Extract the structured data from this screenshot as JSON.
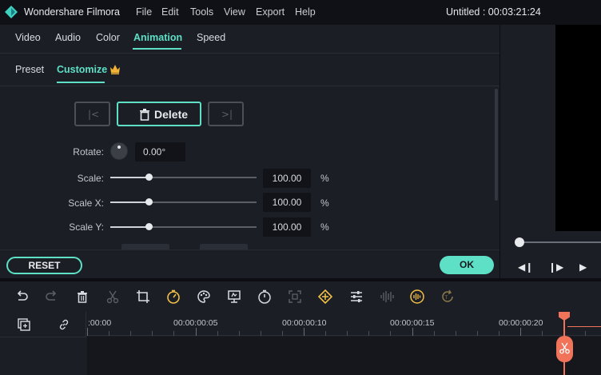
{
  "app": {
    "name": "Wondershare Filmora",
    "project_title": "Untitled : 00:03:21:24"
  },
  "menu": [
    "File",
    "Edit",
    "Tools",
    "View",
    "Export",
    "Help"
  ],
  "edit_tabs": [
    "Video",
    "Audio",
    "Color",
    "Animation",
    "Speed"
  ],
  "edit_tab_active": "Animation",
  "animation_tabs": [
    "Preset",
    "Customize"
  ],
  "animation_tab_active": "Customize",
  "keyframe": {
    "delete_label": "Delete"
  },
  "properties": {
    "rotate": {
      "label": "Rotate:",
      "value": "0.00°"
    },
    "scale": {
      "label": "Scale:",
      "value": "100.00",
      "unit": "%",
      "level": 0.26
    },
    "scale_x": {
      "label": "Scale X:",
      "value": "100.00",
      "unit": "%",
      "level": 0.26
    },
    "scale_y": {
      "label": "Scale Y:",
      "value": "100.00",
      "unit": "%",
      "level": 0.26
    }
  },
  "footer": {
    "reset_label": "RESET",
    "ok_label": "OK"
  },
  "toolbar_icons": [
    "undo-icon",
    "redo-icon",
    "delete-icon",
    "cut-icon",
    "crop-icon",
    "speed-icon",
    "color-icon",
    "mosaic-icon",
    "duration-icon",
    "green-screen-icon",
    "keyframe-icon",
    "adjust-icon",
    "audio-mixer-icon",
    "audio-stretch-icon",
    "speech-to-text-icon"
  ],
  "timeline": {
    "ruler_labels": [
      ":00:00",
      "00:00:00:05",
      "00:00:00:10",
      "00:00:00:15",
      "00:00:00:20"
    ]
  },
  "colors": {
    "accent": "#5de0c6",
    "playhead": "#f0735a",
    "crown": "#f2b233",
    "panel_bg": "#1b1e25"
  }
}
